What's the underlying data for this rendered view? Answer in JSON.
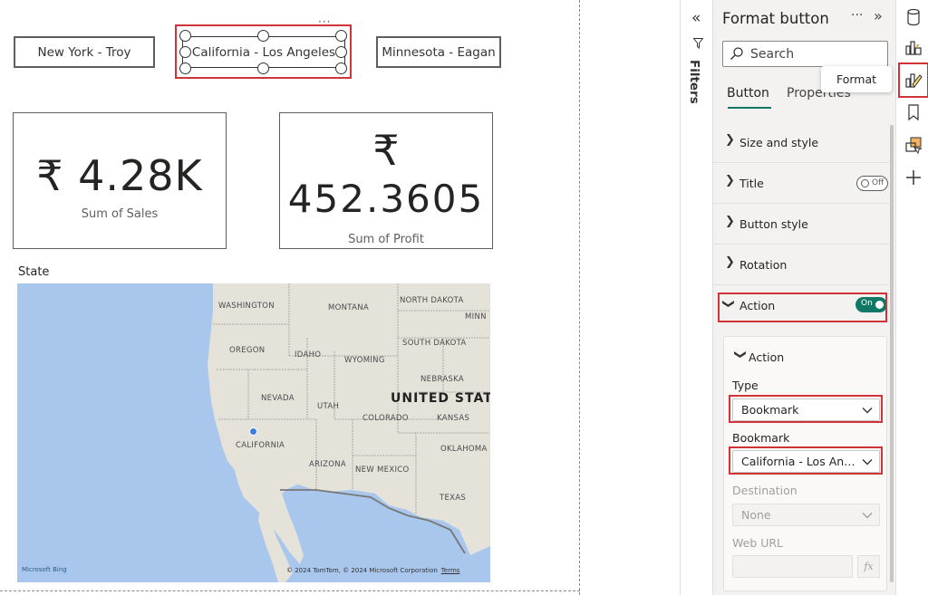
{
  "canvas": {
    "buttons": [
      "New York - Troy",
      "California - Los Angeles",
      "Minnesota - Eagan"
    ],
    "more": "···",
    "cards": {
      "sales": {
        "value": "₹ 4.28K",
        "label": "Sum of Sales"
      },
      "profit": {
        "symbol": "₹",
        "value": "452.3605",
        "label": "Sum of Profit"
      }
    },
    "map": {
      "title": "State",
      "country_label": "UNITED STAT",
      "labels": [
        "WASHINGTON",
        "MONTANA",
        "NORTH DAKOTA",
        "MINN",
        "OREGON",
        "IDAHO",
        "SOUTH DAKOTA",
        "WYOMING",
        "NEBRASKA",
        "NEVADA",
        "UTAH",
        "COLORADO",
        "KANSAS",
        "CALIFORNIA",
        "OKLAHOMA",
        "ARIZONA",
        "NEW MEXICO",
        "TEXAS"
      ],
      "copyright": "© 2024 TomTom, © 2024 Microsoft Corporation",
      "terms": "Terms",
      "logo": "Microsoft Bing"
    }
  },
  "filters": {
    "label": "Filters",
    "collapse_icon": "double-chevron-left-icon"
  },
  "format_pane": {
    "title": "Format button",
    "more": "···",
    "search_placeholder": "Search",
    "tabs": {
      "button": "Button",
      "properties": "Properties"
    },
    "tooltip": "Format",
    "sections": [
      {
        "label": "Size and style"
      },
      {
        "label": "Title",
        "toggle": "Off"
      },
      {
        "label": "Button style"
      },
      {
        "label": "Rotation"
      },
      {
        "label": "Action",
        "toggle": "On"
      }
    ],
    "action_card": {
      "title": "Action",
      "type_label": "Type",
      "type_value": "Bookmark",
      "bookmark_label": "Bookmark",
      "bookmark_value": "California - Los Angeles",
      "destination_label": "Destination",
      "destination_value": "None",
      "weburl_label": "Web URL",
      "fx": "fx"
    }
  },
  "colors": {
    "accent": "#117865",
    "highlight": "#d13438",
    "pane_bg": "#f3f2f1",
    "map_water": "#a9c7ec",
    "map_land": "#e5e2da"
  }
}
